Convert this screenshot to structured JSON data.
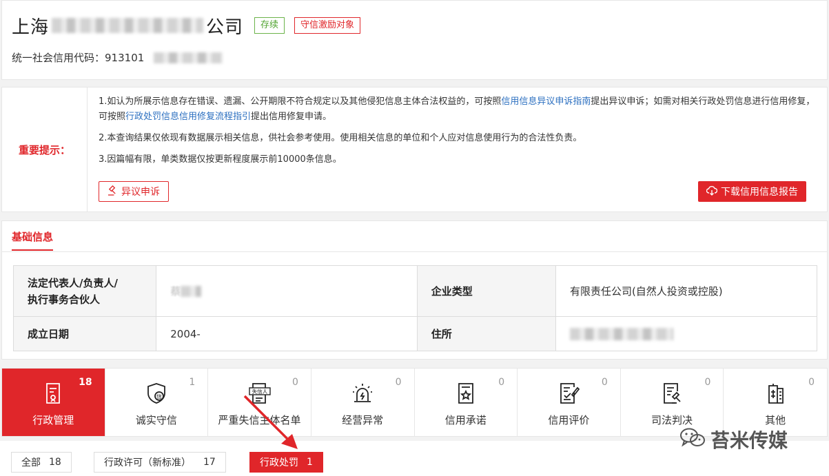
{
  "header": {
    "name_prefix": "上海",
    "name_suffix": "公司",
    "status_tag": "存续",
    "credit_tag": "守信激励对象",
    "uscc_label": "统一社会信用代码：",
    "uscc_value": "913101"
  },
  "notice": {
    "label": "重要提示：",
    "p1_a": "1.如认为所展示信息存在错误、遗漏、公开期限不符合规定以及其他侵犯信息主体合法权益的，可按照",
    "p1_link1": "信用信息异议申诉指南",
    "p1_b": "提出异议申诉；如需对相关行政处罚信息进行信用修复，可按照",
    "p1_link2": "行政处罚信息信用修复流程指引",
    "p1_c": "提出信用修复申请。",
    "p2": "2.本查询结果仅依现有数据展示相关信息，供社会参考使用。使用相关信息的单位和个人应对信息使用行为的合法性负责。",
    "p3": "3.因篇幅有限，单类数据仅按更新程度展示前10000条信息。",
    "appeal_button": "异议申诉",
    "download_button": "下载信用信息报告"
  },
  "basic": {
    "title": "基础信息",
    "legal_rep_label_1": "法定代表人/负责人/",
    "legal_rep_label_2": "执行事务合伙人",
    "legal_rep_value": "蔡",
    "type_label": "企业类型",
    "type_value": "有限责任公司(自然人投资或控股)",
    "date_label": "成立日期",
    "date_value": "2004-",
    "address_label": "住所"
  },
  "tabs": [
    {
      "label": "行政管理",
      "count": "18",
      "icon": "admin-doc-icon"
    },
    {
      "label": "诚实守信",
      "count": "1",
      "icon": "credit-shield-icon"
    },
    {
      "label": "严重失信主体名单",
      "count": "0",
      "icon": "dishonest-list-icon",
      "icon_text": "失信人"
    },
    {
      "label": "经营异常",
      "count": "0",
      "icon": "alarm-icon"
    },
    {
      "label": "信用承诺",
      "count": "0",
      "icon": "promise-doc-icon"
    },
    {
      "label": "信用评价",
      "count": "0",
      "icon": "evaluation-icon"
    },
    {
      "label": "司法判决",
      "count": "0",
      "icon": "judgment-icon"
    },
    {
      "label": "其他",
      "count": "0",
      "icon": "other-doc-icon"
    }
  ],
  "subfilters": [
    {
      "label": "全部",
      "count": "18"
    },
    {
      "label": "行政许可（新标准）",
      "count": "17"
    },
    {
      "label": "行政处罚",
      "count": "1"
    }
  ],
  "watermark": {
    "text": "苔米传媒"
  },
  "colors": {
    "accent": "#e0262a",
    "link": "#2b6fc0",
    "active_status": "#52a432"
  }
}
